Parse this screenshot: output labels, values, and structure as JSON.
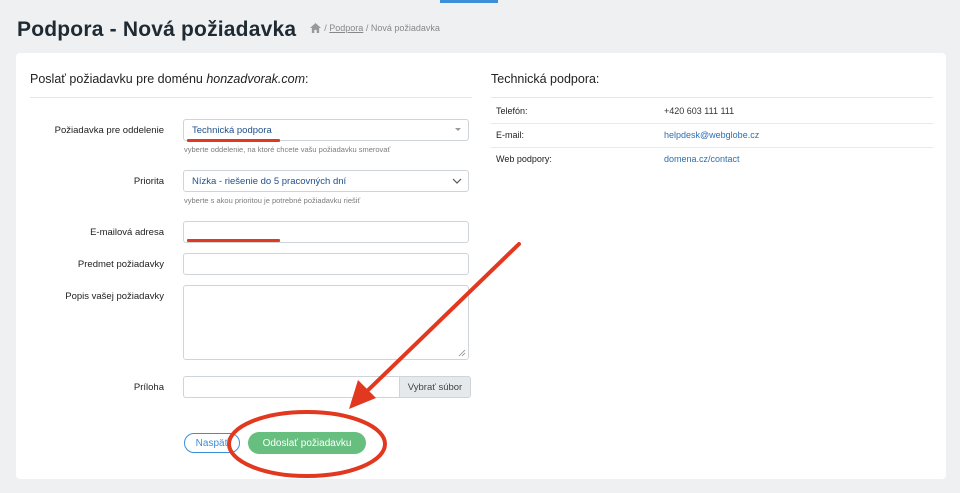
{
  "header": {
    "title": "Podpora - Nová požiadavka",
    "breadcrumb_link": "Podpora",
    "breadcrumb_sep1": "/",
    "breadcrumb_sep2": "/",
    "breadcrumb_current": "Nová požiadavka"
  },
  "form": {
    "heading_prefix": "Poslať požiadavku pre doménu ",
    "domain": "honzadvorak.com",
    "heading_suffix": ":",
    "department_label": "Požiadavka pre oddelenie",
    "department_value": "Technická podpora",
    "department_hint": "vyberte oddelenie, na ktoré chcete vašu požiadavku smerovať",
    "priority_label": "Priorita",
    "priority_value": "Nízka - riešenie do 5 pracovných dní",
    "priority_hint": "vyberte s akou prioritou je potrebné požiadavku riešiť",
    "email_label": "E-mailová adresa",
    "email_value": "",
    "subject_label": "Predmet požiadavky",
    "subject_value": "",
    "description_label": "Popis vašej požiadavky",
    "description_value": "",
    "attachment_label": "Príloha",
    "attachment_button": "Vybrať súbor",
    "back_button": "Naspäť",
    "submit_button": "Odoslať požiadavku"
  },
  "support": {
    "heading": "Technická podpora:",
    "rows": [
      {
        "key": "Telefón:",
        "value": "+420 603 111 111"
      },
      {
        "key": "E-mail:",
        "value": "helpdesk@webglobe.cz"
      },
      {
        "key": "Web podpory:",
        "value": "domena.cz/contact"
      }
    ]
  },
  "colors": {
    "accent_blue": "#3b8fd8",
    "submit_green": "#67bf7f",
    "annotation_red": "#e2381f"
  }
}
